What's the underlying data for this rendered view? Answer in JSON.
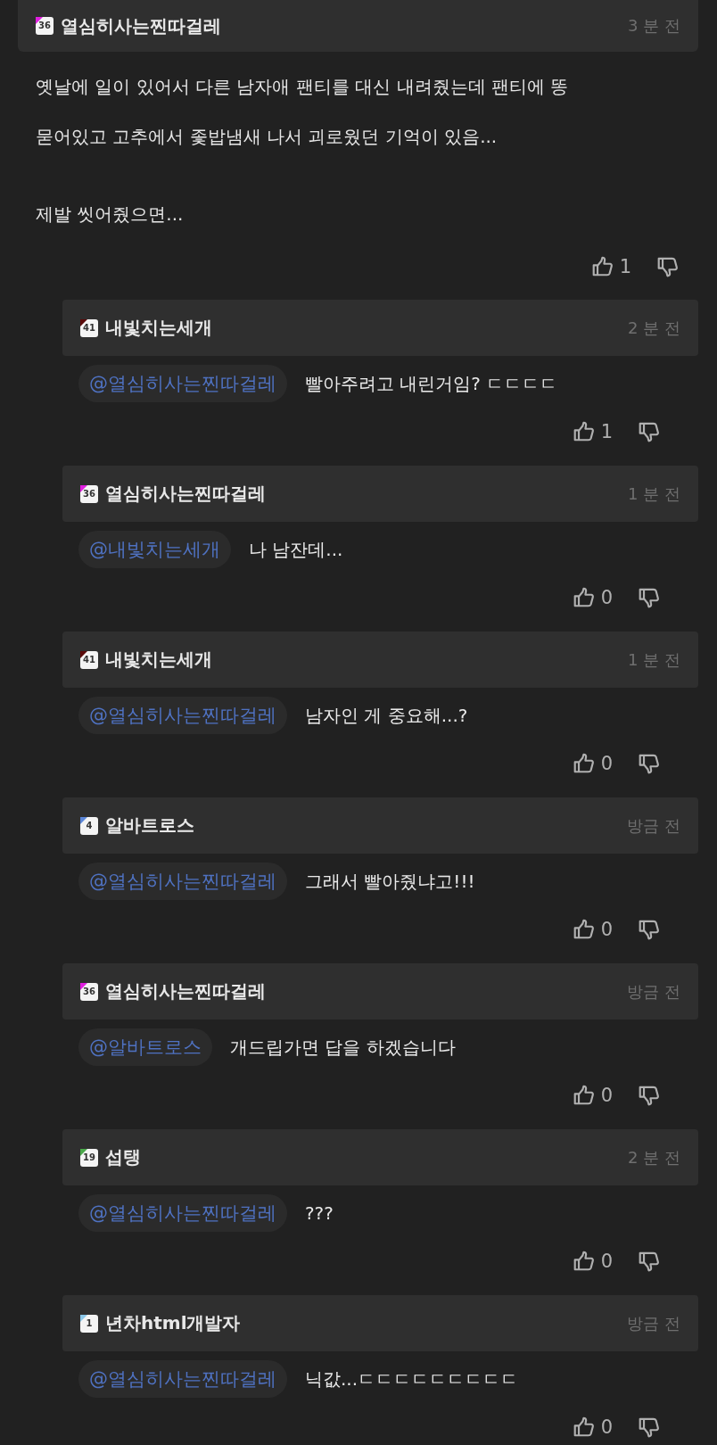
{
  "comment": {
    "author": {
      "name": "열심히사는찐따걸레",
      "level": "36",
      "color": "#e01ee0"
    },
    "time": "3 분 전",
    "body": [
      "옛날에 일이 있어서 다른 남자애 팬티를 대신 내려줬는데 팬티에 똥 묻어있고 고추에서 좇밥냄새 나서 괴로웠던 기억이 있음...",
      "제발 씻어줬으면..."
    ],
    "likes": "1"
  },
  "replies": [
    {
      "author": {
        "name": "내빛치는세개",
        "level": "41",
        "color": "#5a0a0a"
      },
      "time": "2 분 전",
      "mention": "@열심히사는찐따걸레",
      "text": "빨아주려고 내린거임? ㄷㄷㄷㄷ",
      "likes": "1"
    },
    {
      "author": {
        "name": "열심히사는찐따걸레",
        "level": "36",
        "color": "#e01ee0"
      },
      "time": "1 분 전",
      "mention": "@내빛치는세개",
      "text": "나 남잔데...",
      "likes": "0"
    },
    {
      "author": {
        "name": "내빛치는세개",
        "level": "41",
        "color": "#5a0a0a"
      },
      "time": "1 분 전",
      "mention": "@열심히사는찐따걸레",
      "text": "남자인 게 중요해...?",
      "likes": "0"
    },
    {
      "author": {
        "name": "알바트로스",
        "level": "4",
        "color": "#5b86d8"
      },
      "time": "방금 전",
      "mention": "@열심히사는찐따걸레",
      "text": "그래서 빨아줬냐고!!!",
      "likes": "0"
    },
    {
      "author": {
        "name": "열심히사는찐따걸레",
        "level": "36",
        "color": "#e01ee0"
      },
      "time": "방금 전",
      "mention": "@알바트로스",
      "text": "개드립가면 답을 하겠습니다",
      "likes": "0"
    },
    {
      "author": {
        "name": "섭탱",
        "level": "19",
        "color": "#4aa84a"
      },
      "time": "2 분 전",
      "mention": "@열심히사는찐따걸레",
      "text": "???",
      "likes": "0"
    },
    {
      "author": {
        "name": "년차html개발자",
        "level": "1",
        "color": "#8cc8ea"
      },
      "time": "방금 전",
      "mention": "@열심히사는찐따걸레",
      "text": "닉값...ㄷㄷㄷㄷㄷㄷㄷㄷㄷ",
      "likes": "0"
    }
  ]
}
